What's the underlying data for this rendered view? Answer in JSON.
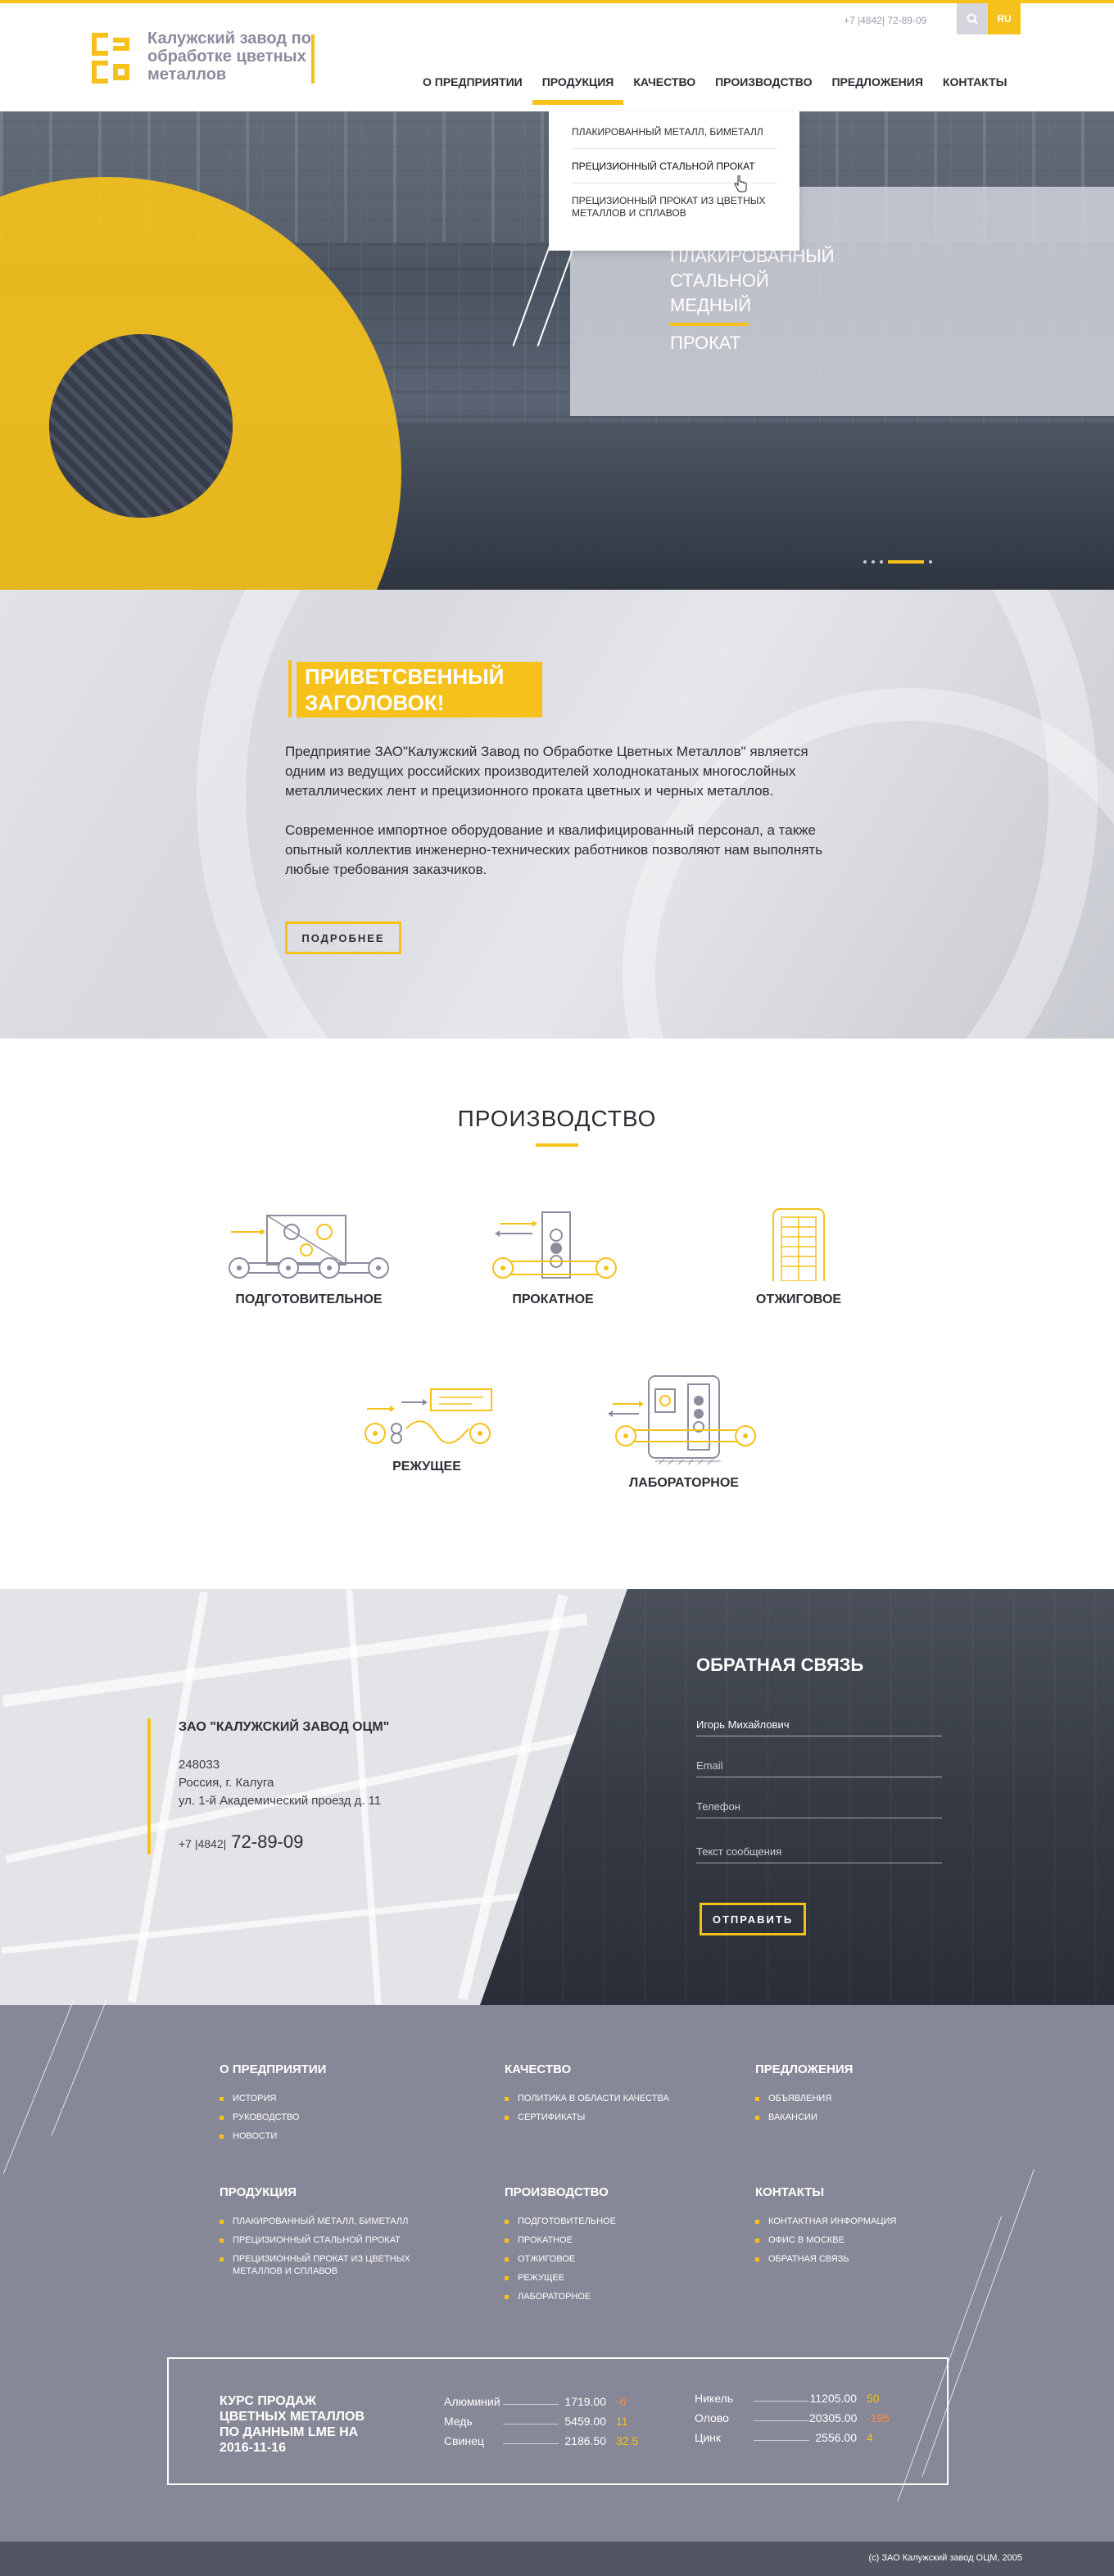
{
  "header": {
    "logo_text": "Калужский завод по обработке цветных металлов",
    "phone": "+7 |4842| 72-89-09",
    "lang": "RU",
    "nav": [
      "О ПРЕДПРИЯТИИ",
      "ПРОДУКЦИЯ",
      "КАЧЕСТВО",
      "ПРОИЗВОДСТВО",
      "ПРЕДЛОЖЕНИЯ",
      "КОНТАКТЫ"
    ],
    "active_nav": "ПРОДУКЦИЯ"
  },
  "dropdown": {
    "items": [
      "ПЛАКИРОВАННЫЙ МЕТАЛЛ, БИМЕТАЛЛ",
      "ПРЕЦИЗИОННЫЙ СТАЛЬНОЙ ПРОКАТ",
      "ПРЕЦИЗИОННЫЙ ПРОКАТ ИЗ ЦВЕТНЫХ МЕТАЛЛОВ И СПЛАВОВ"
    ]
  },
  "hero": {
    "title": "ПЛАКИРОВАННЫЙ СТАЛЬНОЙ МЕДНЫЙ",
    "subtitle": "ПРОКАТ"
  },
  "welcome": {
    "title": "ПРИВЕТСВЕННЫЙ ЗАГОЛОВОК!",
    "paragraph1": "Предприятие ЗАО\"Калужский Завод по Обработке Цветных Металлов\" является одним из ведущих российских производителей холоднокатаных многослойных металлических лент и прецизионного проката цветных и черных металлов.",
    "paragraph2": "Современное импортное оборудование и квалифицированный персонал, а также опытный коллектив инженерно-технических работников позволяют нам выполнять любые требования заказчиков.",
    "button": "ПОДРОБНЕЕ"
  },
  "production": {
    "title": "ПРОИЗВОДСТВО",
    "items": [
      "ПОДГОТОВИТЕЛЬНОЕ",
      "ПРОКАТНОЕ",
      "ОТЖИГОВОЕ",
      "РЕЖУЩЕЕ",
      "ЛАБОРАТОРНОЕ"
    ]
  },
  "contact": {
    "company": "ЗАО \"КАЛУЖСКИЙ ЗАВОД ОЦМ\"",
    "zip": "248033",
    "city": "Россия, г. Калуга",
    "street": "ул. 1-й Академический проезд д. 11",
    "phone_code": "+7 |4842|",
    "phone_number": "72-89-09",
    "form_title": "ОБРАТНАЯ СВЯЗЬ",
    "name_value": "Игорь Михайлович",
    "email_placeholder": "Email",
    "phone_placeholder": "Телефон",
    "message_placeholder": "Текст сообщения",
    "send_button": "ОТПРАВИТЬ"
  },
  "footer": {
    "columns": [
      {
        "title": "О ПРЕДПРИЯТИИ",
        "links": [
          "ИСТОРИЯ",
          "РУКОВОДСТВО",
          "НОВОСТИ"
        ]
      },
      {
        "title": "КАЧЕСТВО",
        "links": [
          "ПОЛИТИКА В ОБЛАСТИ КАЧЕСТВА",
          "СЕРТИФИКАТЫ"
        ]
      },
      {
        "title": "ПРЕДЛОЖЕНИЯ",
        "links": [
          "ОБЪЯВЛЕНИЯ",
          "ВАКАНСИИ"
        ]
      },
      {
        "title": "ПРОДУКЦИЯ",
        "links": [
          "ПЛАКИРОВАННЫЙ МЕТАЛЛ, БИМЕТАЛЛ",
          "ПРЕЦИЗИОННЫЙ СТАЛЬНОЙ ПРОКАТ",
          "ПРЕЦИЗИОННЫЙ ПРОКАТ ИЗ ЦВЕТНЫХ МЕТАЛЛОВ И СПЛАВОВ"
        ]
      },
      {
        "title": "ПРОИЗВОДСТВО",
        "links": [
          "ПОДГОТОВИТЕЛЬНОЕ",
          "ПРОКАТНОЕ",
          "ОТЖИГОВОЕ",
          "РЕЖУЩЕЕ",
          "ЛАБОРАТОРНОЕ"
        ]
      },
      {
        "title": "КОНТАКТЫ",
        "links": [
          "КОНТАКТНАЯ ИНФОРМАЦИЯ",
          "ОФИС В МОСКВЕ",
          "ОБРАТНАЯ СВЯЗЬ"
        ]
      }
    ],
    "rates_title": "КУРС ПРОДАЖ ЦВЕТНЫХ МЕТАЛЛОВ ПО ДАННЫМ LME НА 2016-11-16",
    "rates_left": [
      {
        "name": "Алюминий",
        "value": "1719.00",
        "change": "-6",
        "color": "#ff8a3d"
      },
      {
        "name": "Медь",
        "value": "5459.00",
        "change": "11",
        "color": "#f5c11a"
      },
      {
        "name": "Свинец",
        "value": "2186.50",
        "change": "32.5",
        "color": "#f5c11a"
      }
    ],
    "rates_right": [
      {
        "name": "Никель",
        "value": "11205.00",
        "change": "50",
        "color": "#f5c11a"
      },
      {
        "name": "Олово",
        "value": "20305.00",
        "change": "-195",
        "color": "#ff8a3d"
      },
      {
        "name": "Цинк",
        "value": "2556.00",
        "change": "4",
        "color": "#f5c11a"
      }
    ],
    "copyright": "(с) ЗАО Калужский завод ОЦМ, 2005"
  }
}
